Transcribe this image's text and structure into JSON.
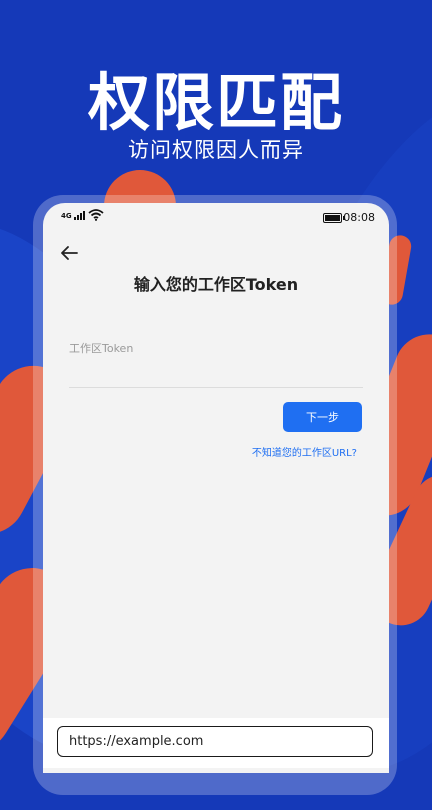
{
  "hero": {
    "title": "权限匹配",
    "subtitle": "访问权限因人而异"
  },
  "status_bar": {
    "network": "4G",
    "time": "08:08"
  },
  "page": {
    "title": "输入您的工作区Token",
    "field_label": "工作区Token",
    "field_value": "",
    "next_button": "下一步",
    "help_link": "不知道您的工作区URL?"
  },
  "url_bar": {
    "value": "https://example.com"
  },
  "colors": {
    "background": "#1539b8",
    "accent_shapes": "#e0583a",
    "primary_button": "#1f6ff2",
    "screen": "#f3f3f3"
  },
  "icons": [
    "back-arrow-icon",
    "signal-icon",
    "wifi-icon",
    "battery-icon"
  ]
}
